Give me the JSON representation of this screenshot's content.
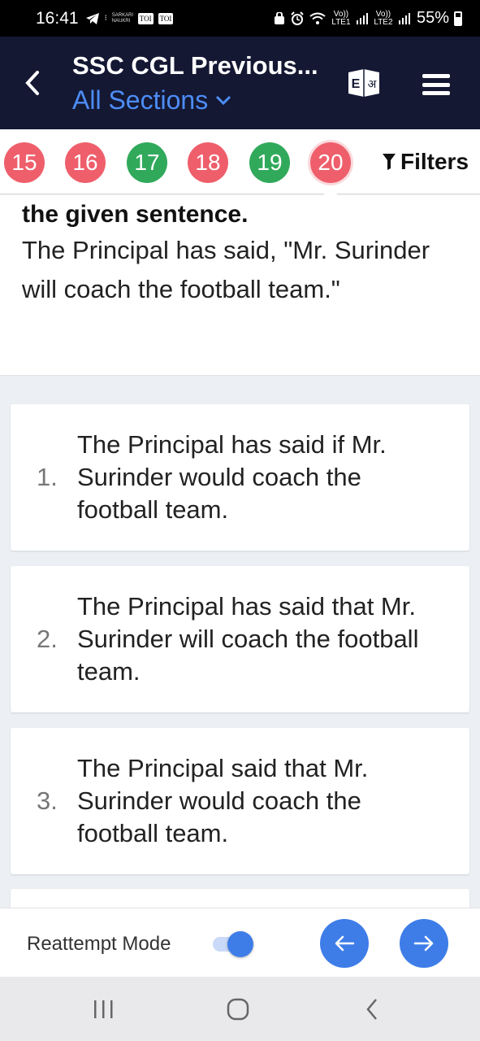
{
  "status_bar": {
    "time": "16:41",
    "badges": [
      "TOI",
      "TOI"
    ],
    "mini_text": "SARKARI NAUKRI",
    "network_1": "Vo)) LTE1",
    "network_2": "Vo)) LTE2",
    "battery": "55%",
    "icons": [
      "telegram-icon",
      "notification-icon",
      "alarm-icon",
      "wifi-icon",
      "signal-icon",
      "battery-icon"
    ]
  },
  "header": {
    "title": "SSC CGL Previous...",
    "subtitle": "All Sections",
    "icons": [
      "back-arrow-icon",
      "language-toggle-icon",
      "hamburger-menu-icon",
      "chevron-down-icon"
    ],
    "lang_glyphs": [
      "E",
      "अ"
    ]
  },
  "question_nav": {
    "items": [
      {
        "number": "15",
        "status": "incorrect"
      },
      {
        "number": "16",
        "status": "incorrect"
      },
      {
        "number": "17",
        "status": "correct"
      },
      {
        "number": "18",
        "status": "incorrect"
      },
      {
        "number": "19",
        "status": "correct"
      },
      {
        "number": "20",
        "status": "incorrect",
        "active": true
      }
    ],
    "filters_label": "Filters",
    "colors": {
      "incorrect": "#ee5f6b",
      "correct": "#31a95b"
    }
  },
  "question": {
    "instruction_tail": "the given sentence.",
    "text": "The Principal has said, \"Mr. Surinder will coach the football team.\""
  },
  "options": [
    {
      "number": "1.",
      "text": "The Principal has said if Mr. Surinder would coach the football team."
    },
    {
      "number": "2.",
      "text": "The Principal has said that Mr. Surinder will coach the football team."
    },
    {
      "number": "3.",
      "text": "The Principal said that Mr. Surinder would coach the football team."
    }
  ],
  "bottom_bar": {
    "reattempt_label": "Reattempt Mode",
    "reattempt_on": true,
    "accent": "#3e7de8"
  },
  "system_nav": {
    "icons": [
      "recent-apps-icon",
      "home-icon",
      "system-back-icon"
    ]
  }
}
